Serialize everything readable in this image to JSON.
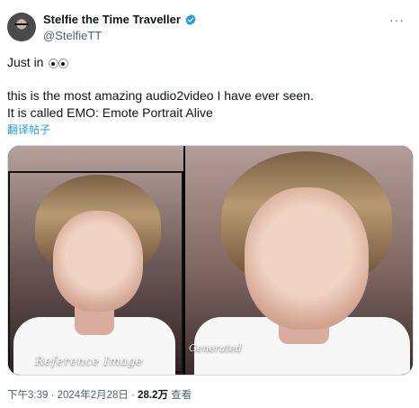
{
  "author": {
    "name": "Stelfie the Time Traveller",
    "handle": "@StelfieTT",
    "verified": true,
    "avatar_icon": "user-avatar"
  },
  "more_icon": "more-options-icon",
  "tweet": {
    "line1": "Just in",
    "line2": "this is the most amazing audio2video I have ever seen.",
    "line3": "It is called EMO: Emote Portrait Alive",
    "translate_label": "翻译帖子"
  },
  "media": {
    "left_caption": "Reference Image",
    "right_caption": "Generated"
  },
  "meta": {
    "time": "下午3:39",
    "dot1": " · ",
    "date": "2024年2月28日",
    "dot2": " · ",
    "views_count": "28.2万",
    "views_label": " 查看"
  },
  "colors": {
    "accent": "#1d9bf0",
    "text_secondary": "#536471",
    "border": "#cfd9de"
  }
}
